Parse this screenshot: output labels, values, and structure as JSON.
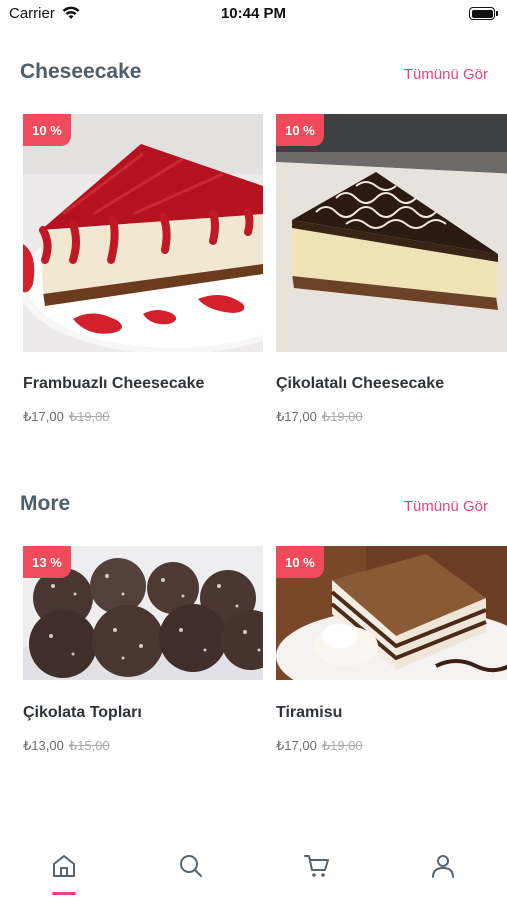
{
  "status_bar": {
    "carrier": "Carrier",
    "time": "10:44 PM"
  },
  "sections": [
    {
      "title": "Cheseecake",
      "see_all": "Tümünü Gör",
      "products": [
        {
          "name": "Frambuazlı Cheesecake",
          "discount": "10 %",
          "price": "₺17,00",
          "old_price": "₺19,00"
        },
        {
          "name": "Çikolatalı Cheesecake",
          "discount": "10 %",
          "price": "₺17,00",
          "old_price": "₺19,00"
        }
      ]
    },
    {
      "title": "More",
      "see_all": "Tümünü Gör",
      "products": [
        {
          "name": "Çikolata Topları",
          "discount": "13 %",
          "price": "₺13,00",
          "old_price": "₺15,00"
        },
        {
          "name": "Tiramisu",
          "discount": "10 %",
          "price": "₺17,00",
          "old_price": "₺19,00"
        }
      ]
    }
  ],
  "tab_bar": {
    "tabs": [
      {
        "icon": "home-icon",
        "active": true
      },
      {
        "icon": "search-icon",
        "active": false
      },
      {
        "icon": "cart-icon",
        "active": false
      },
      {
        "icon": "profile-icon",
        "active": false
      }
    ],
    "accent": "#e6457a"
  },
  "colors": {
    "accent": "#e6457a",
    "badge": "#ef4b5c",
    "title": "#4d5f6b"
  }
}
